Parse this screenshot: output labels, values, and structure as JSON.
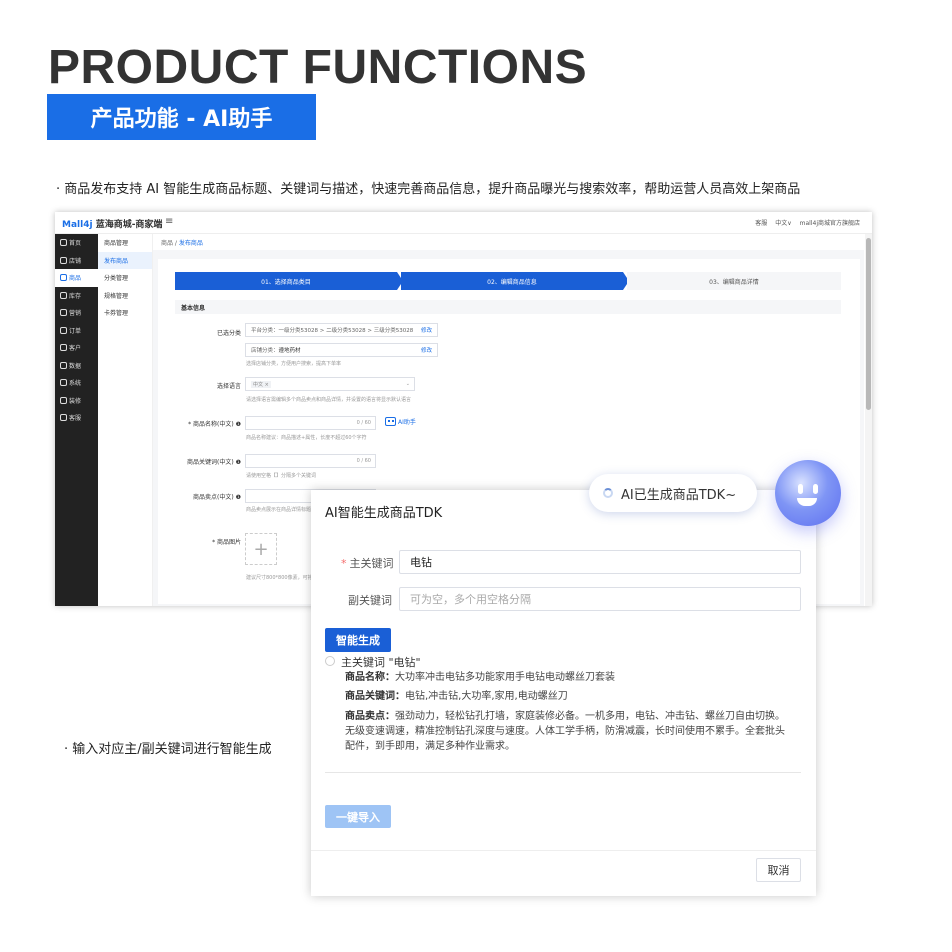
{
  "hero": {
    "title": "PRODUCT FUNCTIONS",
    "subtitle": "产品功能 - AI助手",
    "accent_color": "#1a6ee6"
  },
  "bullets": [
    "· 商品发布支持 AI 智能生成商品标题、关键词与描述，快速完善商品信息，提升商品曝光与搜索效率，帮助运营人员高效上架商品",
    "· 输入对应主/副关键词进行智能生成"
  ],
  "app": {
    "logo_mark": "Mall4j",
    "shop_name": "蓝海商城-商家端",
    "menu_icon": "≡",
    "topbar": {
      "service": "客服",
      "language": "中文∨",
      "store": "mall4j商城官方旗舰店"
    },
    "sidebar": [
      {
        "icon": "home-icon",
        "label": "首页"
      },
      {
        "icon": "store-icon",
        "label": "店铺"
      },
      {
        "icon": "goods-icon",
        "label": "商品"
      },
      {
        "icon": "inventory-icon",
        "label": "库存"
      },
      {
        "icon": "marketing-icon",
        "label": "营销"
      },
      {
        "icon": "order-icon",
        "label": "订单"
      },
      {
        "icon": "customer-icon",
        "label": "客户"
      },
      {
        "icon": "data-icon",
        "label": "数据"
      },
      {
        "icon": "system-icon",
        "label": "系统"
      },
      {
        "icon": "decor-icon",
        "label": "装修"
      },
      {
        "icon": "service-icon",
        "label": "客服"
      }
    ],
    "submenu": [
      "商品管理",
      "发布商品",
      "分类管理",
      "规格管理",
      "卡券管理"
    ],
    "breadcrumb": {
      "root": "商品",
      "sep": " / ",
      "current": "发布商品"
    },
    "steps": [
      "01、选择商品类目",
      "02、编辑商品信息",
      "03、编辑商品详情"
    ],
    "section": "基本信息",
    "form": {
      "category_label": "已选分类",
      "platform_category": "平台分类：一级分类53028 > 二级分类53028 > 三级分类53028",
      "shop_category_prefix": "店铺分类：",
      "shop_category": "遵地药材",
      "edit": "修改",
      "category_hint": "选择店铺分类，方便用户搜索，提高下单率",
      "language_label": "选择语言",
      "language_tag": "中文 ×",
      "language_hint": "请选择语言需编辑多个商品卖点和商品详情，并设置的语言将显示默认语言",
      "name_label": "* 商品名称(中文) ❶",
      "name_counter": "0 / 60",
      "name_hint": "商品名称建议：商品描述+属性，长度不超过60个字符",
      "ai_helper": "AI助手",
      "keywords_label": "商品关键词(中文) ❶",
      "keywords_counter": "0 / 60",
      "keywords_hint": "请使用空格【】分隔多个关键词",
      "selling_label": "商品卖点(中文) ❶",
      "selling_hint": "商品卖点展示在商品详情标题下",
      "image_label": "* 商品图片",
      "image_hint": "建议尺寸800*800像素，可拖"
    }
  },
  "dialog": {
    "title": "AI智能生成商品TDK",
    "main_kw_label": "主关键词",
    "main_kw_value": "电钻",
    "sub_kw_label": "副关键词",
    "sub_kw_placeholder": "可为空，多个用空格分隔",
    "generate_button": "智能生成",
    "result_title": "主关键词 \"电钻\"",
    "result": {
      "name_label": "商品名称：",
      "name_value": "大功率冲击电钻多功能家用手电钻电动螺丝刀套装",
      "kw_label": "商品关键词：",
      "kw_value": "电钻,冲击钻,大功率,家用,电动螺丝刀",
      "sell_label": "商品卖点：",
      "sell_value": "强劲动力，轻松钻孔打墙，家庭装修必备。一机多用，电钻、冲击钻、螺丝刀自由切换。无级变速调速，精准控制钻孔深度与速度。人体工学手柄，防滑减震，长时间使用不累手。全套批头配件，到手即用，满足多种作业需求。"
    },
    "import_button": "一键导入",
    "cancel_button": "取消"
  },
  "bubble": {
    "text": "AI已生成商品TDK~"
  }
}
